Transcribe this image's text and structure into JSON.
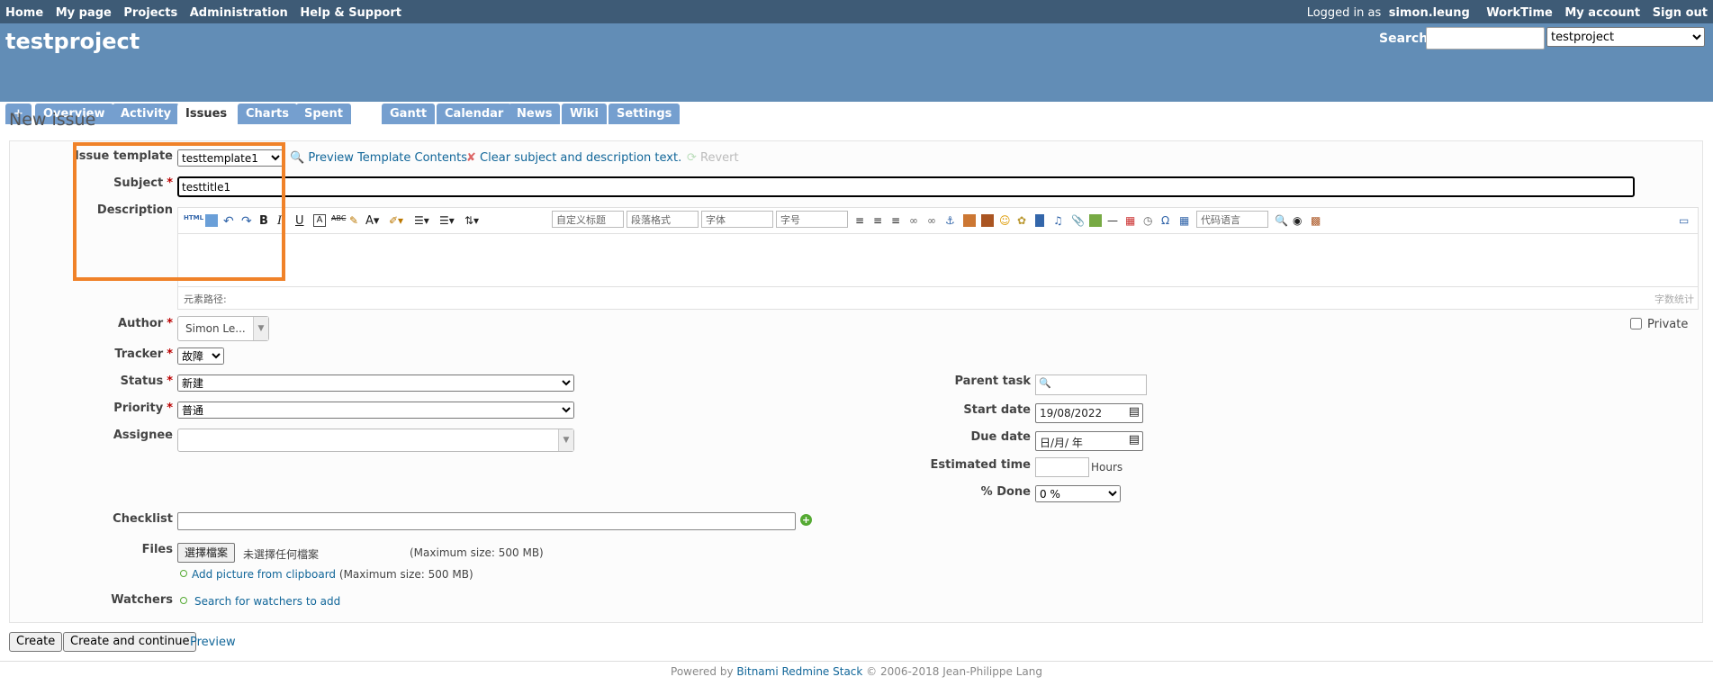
{
  "topnav": {
    "left": [
      "Home",
      "My page",
      "Projects",
      "Administration",
      "Help & Support"
    ],
    "logged_in_prefix": "Logged in as",
    "username": "simon.leung",
    "right": [
      "WorkTime",
      "My account",
      "Sign out"
    ]
  },
  "header": {
    "project_title": "testproject",
    "search_label": "Search:",
    "project_select": "testproject"
  },
  "tabs": [
    "+",
    "Overview",
    "Activity",
    "Issues",
    "Charts",
    "Spent time",
    "Gantt",
    "Calendar",
    "News",
    "Wiki",
    "Settings"
  ],
  "page_title": "New issue",
  "form": {
    "issue_template_label": "Issue template",
    "issue_template_value": "testtemplate1",
    "preview_template": "Preview Template Contents",
    "clear_text": "Clear subject and description text.",
    "revert": "Revert",
    "subject_label": "Subject",
    "subject_value": "testtitle1",
    "description_label": "Description",
    "toolbar_selects": [
      "自定义标题",
      "段落格式",
      "字体",
      "字号",
      "代码语言"
    ],
    "element_path": "元素路径:",
    "word_count": "字数统计",
    "author_label": "Author",
    "author_value": "Simon Le...",
    "private_label": "Private",
    "tracker_label": "Tracker",
    "tracker_value": "故障",
    "status_label": "Status",
    "status_value": "新建",
    "priority_label": "Priority",
    "priority_value": "普通",
    "assignee_label": "Assignee",
    "parent_task_label": "Parent task",
    "start_date_label": "Start date",
    "start_date_value": "19/08/2022",
    "due_date_label": "Due date",
    "due_date_value": "日/月/ 年",
    "estimated_time_label": "Estimated time",
    "hours_label": "Hours",
    "done_label": "% Done",
    "done_value": "0 %",
    "checklist_label": "Checklist",
    "files_label": "Files",
    "choose_file": "選擇檔案",
    "no_file": "未選擇任何檔案",
    "max_size": "(Maximum size: 500 MB)",
    "add_picture": "Add picture from clipboard",
    "add_picture_size": "(Maximum size: 500 MB)",
    "watchers_label": "Watchers",
    "search_watchers": "Search for watchers to add"
  },
  "buttons": {
    "create": "Create",
    "create_continue": "Create and continue",
    "preview": "Preview"
  },
  "footer": {
    "powered": "Powered by",
    "link": "Bitnami Redmine Stack",
    "copyright": "© 2006-2018 Jean-Philippe Lang"
  },
  "colors": {
    "topbar": "#3e5b76",
    "header": "#628db6",
    "tab": "#759fcf",
    "highlight": "#f08229",
    "required": "#bb0000"
  }
}
